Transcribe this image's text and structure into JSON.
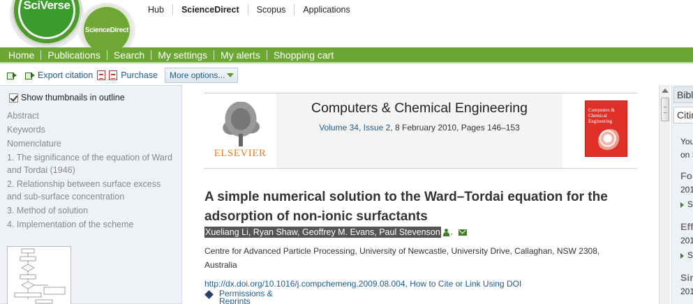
{
  "header": {
    "sciverse_logo": "SciVerse",
    "sciencedirect_logo": "ScienceDirect",
    "top_nav": [
      "Hub",
      "ScienceDirect",
      "Scopus",
      "Applications"
    ]
  },
  "main_nav": [
    "Home",
    "Publications",
    "Search",
    "My settings",
    "My alerts",
    "Shopping cart"
  ],
  "toolbar": {
    "export_label": "Export citation",
    "purchase_label": "Purchase",
    "more_options_label": "More options..."
  },
  "outline": {
    "show_thumbnails_label": "Show thumbnails in outline",
    "show_thumbnails_checked": true,
    "items": [
      "Abstract",
      "Keywords",
      "Nomenclature",
      "1. The significance of the equation of Ward and Tordai (1946)",
      "2. Relationship between surface excess and sub-surface concentration",
      "3. Method of solution",
      "4. Implementation of the scheme"
    ]
  },
  "journal": {
    "publisher": "ELSEVIER",
    "title": "Computers & Chemical Engineering",
    "volume_link": "Volume 34",
    "issue_link": "Issue 2",
    "date_pages": ", 8 February 2010, Pages 146–153",
    "cover_title": "Computers & Chemical Engineering"
  },
  "article": {
    "title": "A simple numerical solution to the Ward–Tordai equation for the adsorption of non-ionic surfactants",
    "authors": "Xueliang Li, Ryan Shaw, Geoffrey M. Evans, Paul Stevenson",
    "affiliation": "Centre for Advanced Particle Processing, University of Newcastle, University Drive, Callaghan, NSW 2308, Australia",
    "doi": "http://dx.doi.org/10.1016/j.compchemeng.2009.08.004",
    "cite_link": "How to Cite or Link Using DOI",
    "permissions_line1": "Permissions &",
    "permissions_line2": "Reprints"
  },
  "right_panel": {
    "tab1": "Bibl",
    "tab2": "Citin",
    "text_1": "You",
    "text_2": "on S",
    "head_1": "Fo",
    "year_1": "201",
    "link_1": "S",
    "head_2": "Eff",
    "year_2": "201",
    "link_2": "S",
    "head_3": "Sir",
    "year_3": "201"
  },
  "colors": {
    "nav_green": "#6ca734",
    "link_blue": "#1e5b8f",
    "elsevier_orange": "#e6821e",
    "cover_red": "#de3028"
  }
}
